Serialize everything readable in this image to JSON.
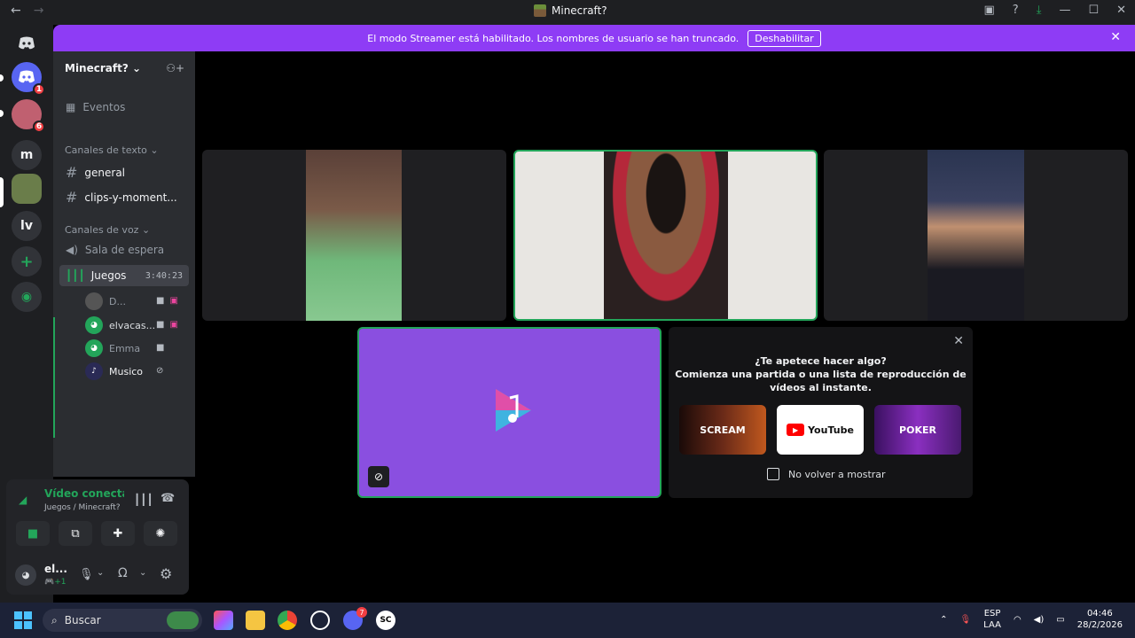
{
  "window": {
    "back_arrow": "←",
    "forward_arrow": "→",
    "title": "Minecraft?"
  },
  "banner": {
    "text": "El modo Streamer está habilitado. Los nombres de usuario se han truncado.",
    "button": "Deshabilitar",
    "close": "✕"
  },
  "guilds": {
    "items": [
      {
        "label": "m"
      },
      {
        "label": "lv"
      }
    ],
    "badges": [
      "1",
      "6"
    ],
    "add": "+"
  },
  "server": {
    "name": "Minecraft?",
    "events": "Eventos",
    "text_category": "Canales de texto",
    "text_channels": [
      "general",
      "clips-y-moment..."
    ],
    "voice_category": "Canales de voz",
    "waiting_room": "Sala de espera",
    "active_voice": {
      "name": "Juegos",
      "timer": "3:40:23"
    },
    "voice_users": [
      {
        "name": "D..."
      },
      {
        "name": "elvacas..."
      },
      {
        "name": "Emma"
      },
      {
        "name": "Musico"
      }
    ]
  },
  "rtc": {
    "status": "Vídeo conectado",
    "location": "Juegos / Minecraft?"
  },
  "user": {
    "name": "el...",
    "activity": "+1"
  },
  "activity": {
    "prompt_line1": "¿Te apetece hacer algo?",
    "prompt_line2": "Comienza una partida o una lista de reproducción de",
    "prompt_line3": "vídeos al instante.",
    "cards": [
      {
        "label": "SCREAM",
        "color": "#3b1a12"
      },
      {
        "label": "YouTube",
        "color": "#ffffff"
      },
      {
        "label": "POKER",
        "color": "#5a1f8c"
      }
    ],
    "dont_show": "No volver a mostrar",
    "close": "✕"
  },
  "taskbar": {
    "search_placeholder": "Buscar",
    "discord_badge": "7",
    "lang_top": "ESP",
    "lang_bottom": "LAA",
    "time": "04:46",
    "date": "28/2/2026"
  },
  "colors": {
    "blurple": "#5865f2",
    "streamer_purple": "#8e3cf5",
    "green": "#23a55a",
    "activity_purple": "#8a4fe0"
  }
}
